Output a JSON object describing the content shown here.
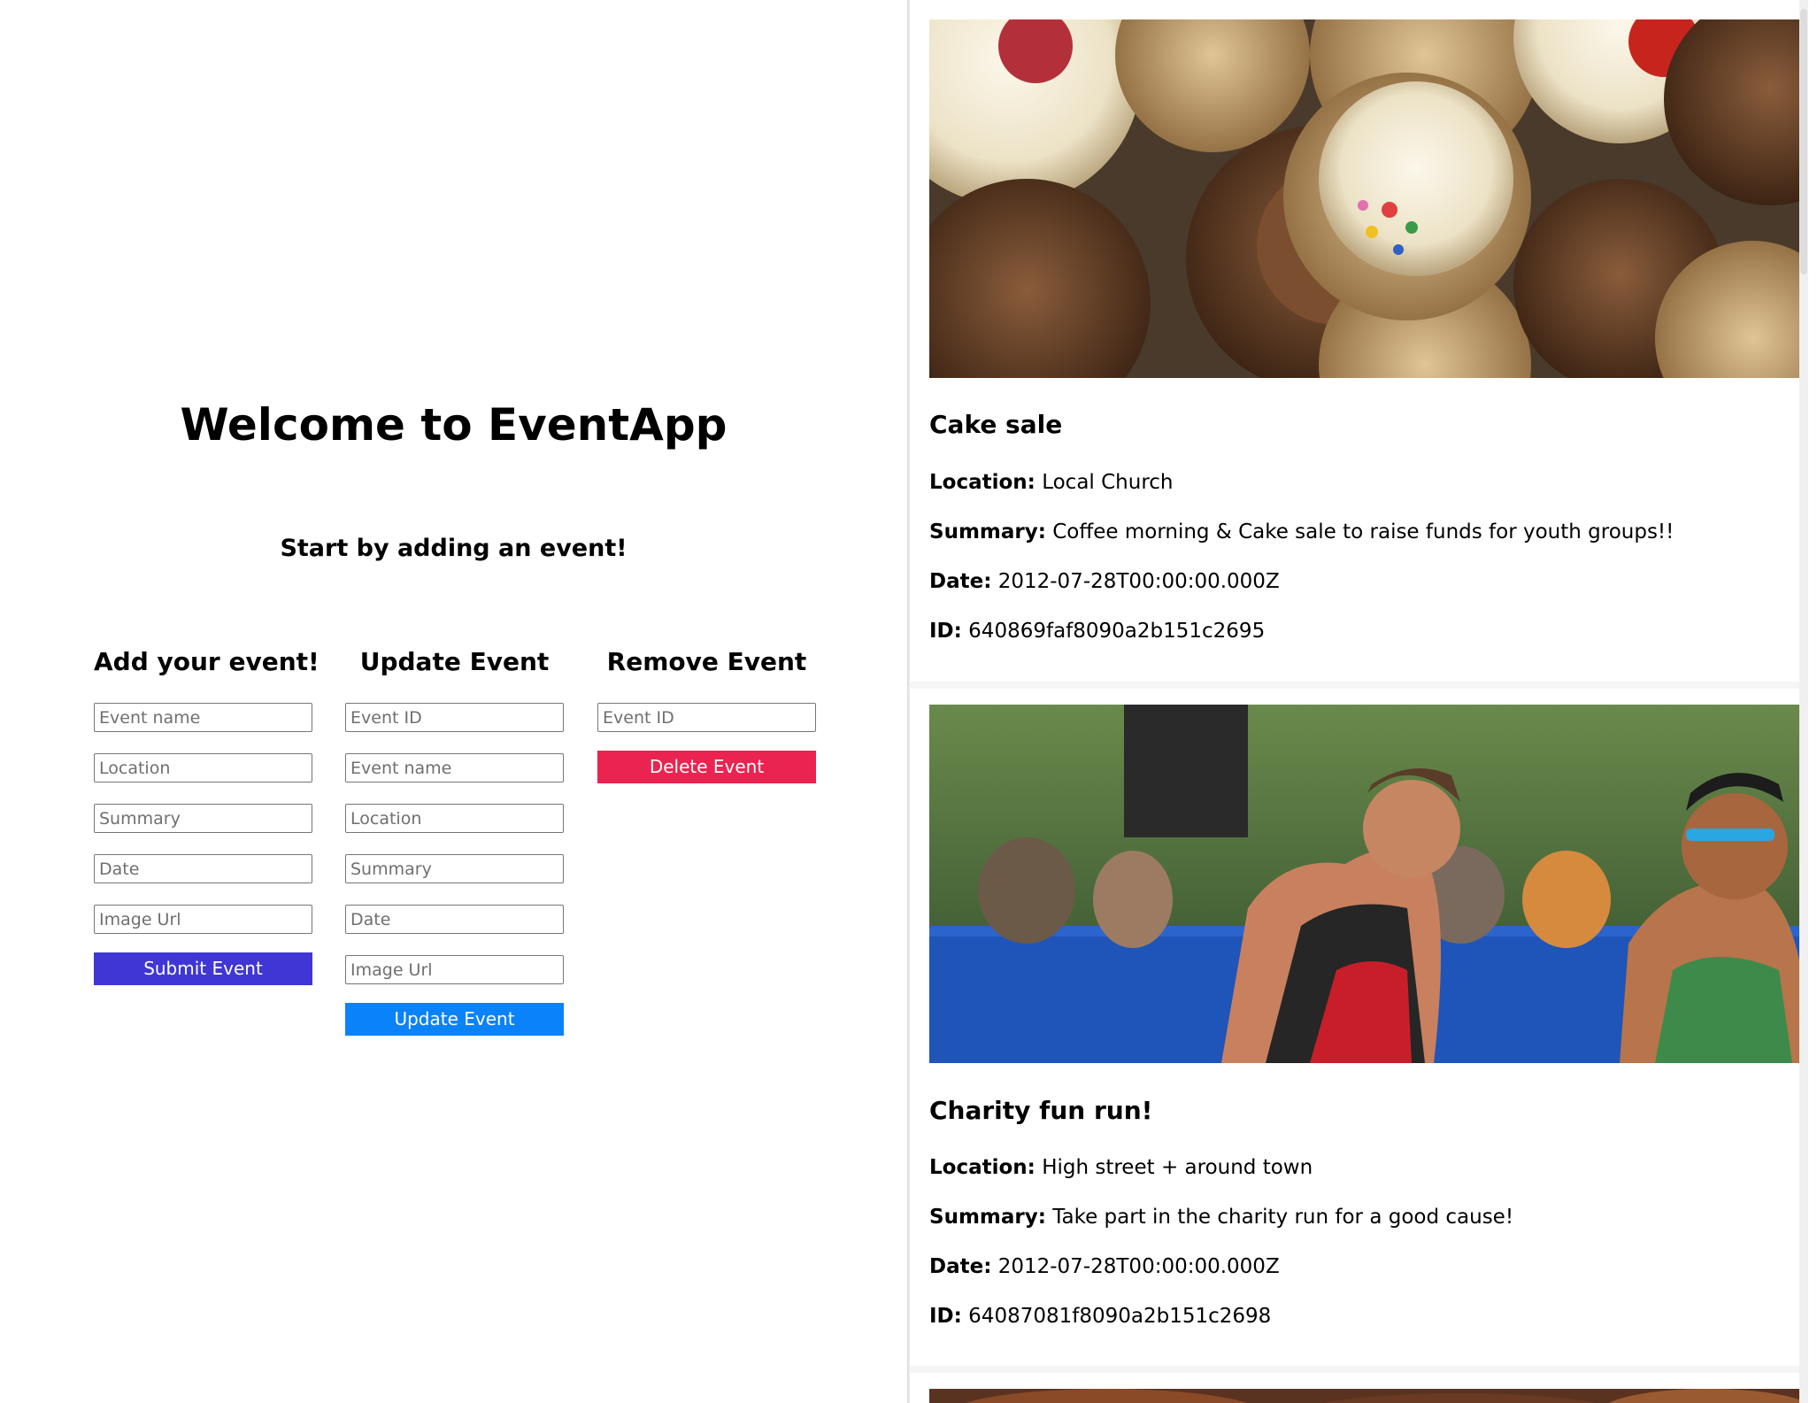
{
  "app": {
    "welcome": "Welcome to EventApp",
    "subtitle": "Start by adding an event!"
  },
  "forms": {
    "add": {
      "heading": "Add your event!",
      "fields": {
        "event_name": "Event name",
        "location": "Location",
        "summary": "Summary",
        "date": "Date",
        "image_url": "Image Url"
      },
      "button": "Submit Event",
      "button_color": "#4036d6"
    },
    "update": {
      "heading": "Update Event",
      "fields": {
        "event_id": "Event ID",
        "event_name": "Event name",
        "location": "Location",
        "summary": "Summary",
        "date": "Date",
        "image_url": "Image Url"
      },
      "button": "Update Event",
      "button_color": "#0a82fa"
    },
    "remove": {
      "heading": "Remove Event",
      "fields": {
        "event_id": "Event ID"
      },
      "button": "Delete Event",
      "button_color": "#ea2350"
    }
  },
  "labels": {
    "location": "Location:",
    "summary": "Summary:",
    "date": "Date:",
    "id": "ID:"
  },
  "events": [
    {
      "title": "Cake sale",
      "location": "Local Church",
      "summary": "Coffee morning & Cake sale to raise funds for youth groups!!",
      "date": "2012-07-28T00:00:00.000Z",
      "id": "640869faf8090a2b151c2695",
      "image_icon": "cupcakes-photo"
    },
    {
      "title": "Charity fun run!",
      "location": "High street + around town",
      "summary": "Take part in the charity run for a good cause!",
      "date": "2012-07-28T00:00:00.000Z",
      "id": "64087081f8090a2b151c2698",
      "image_icon": "runners-photo"
    }
  ]
}
